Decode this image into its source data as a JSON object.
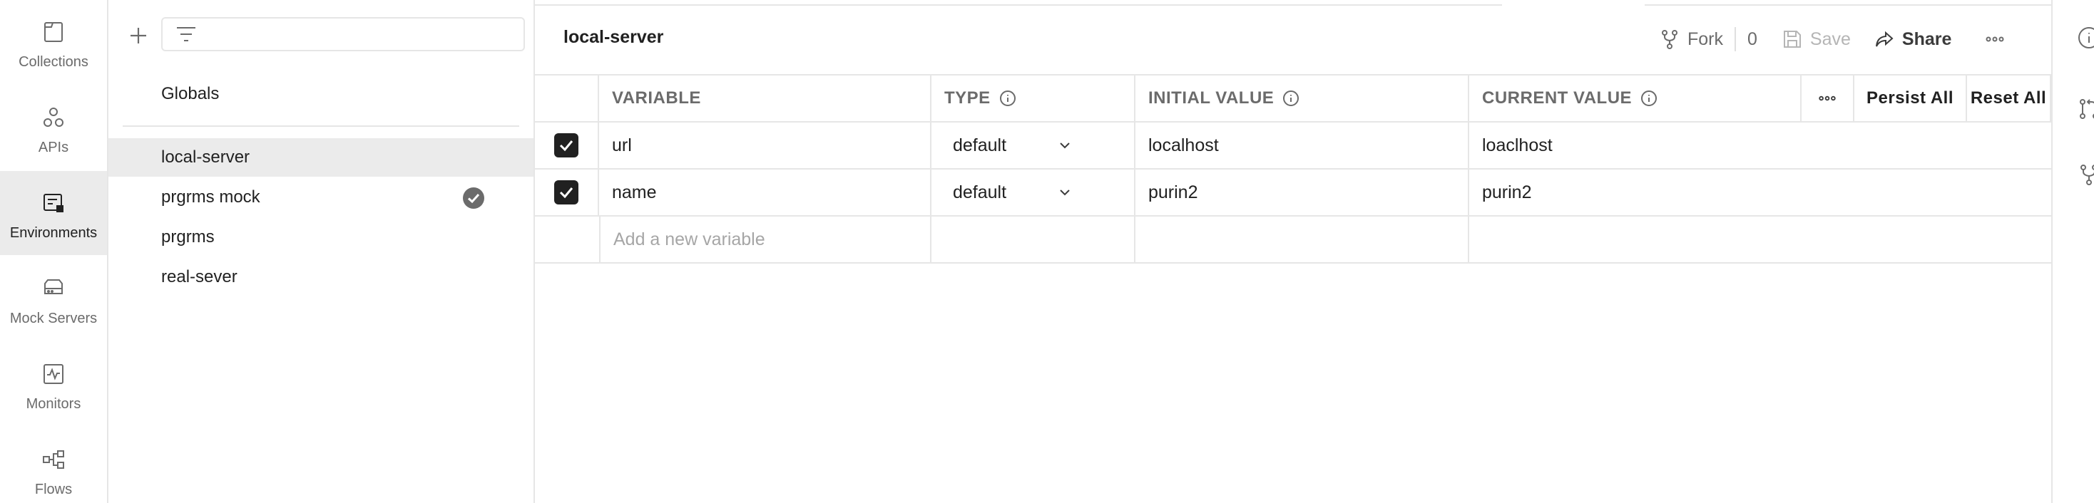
{
  "nav": {
    "items": [
      {
        "label": "Collections",
        "icon": "collections-icon",
        "active": false
      },
      {
        "label": "APIs",
        "icon": "apis-icon",
        "active": false
      },
      {
        "label": "Environments",
        "icon": "environments-icon",
        "active": true
      },
      {
        "label": "Mock Servers",
        "icon": "mock-servers-icon",
        "active": false
      },
      {
        "label": "Monitors",
        "icon": "monitors-icon",
        "active": false
      },
      {
        "label": "Flows",
        "icon": "flows-icon",
        "active": false
      }
    ]
  },
  "sidebar": {
    "filter_placeholder": "",
    "globals_label": "Globals",
    "environments": [
      {
        "name": "local-server",
        "selected": true,
        "active": false
      },
      {
        "name": "prgrms mock",
        "selected": false,
        "active": true
      },
      {
        "name": "prgrms",
        "selected": false,
        "active": false
      },
      {
        "name": "real-sever",
        "selected": false,
        "active": false
      }
    ]
  },
  "main": {
    "title": "local-server",
    "actions": {
      "fork_label": "Fork",
      "fork_count": "0",
      "save_label": "Save",
      "share_label": "Share"
    },
    "table": {
      "headers": {
        "variable": "VARIABLE",
        "type": "TYPE",
        "initial_value": "INITIAL VALUE",
        "current_value": "CURRENT VALUE",
        "persist_all": "Persist All",
        "reset_all": "Reset All"
      },
      "rows": [
        {
          "enabled": true,
          "variable": "url",
          "type": "default",
          "initial_value": "localhost",
          "current_value": "loaclhost"
        },
        {
          "enabled": true,
          "variable": "name",
          "type": "default",
          "initial_value": "purin2",
          "current_value": "purin2"
        }
      ],
      "new_variable_placeholder": "Add a new variable"
    }
  },
  "colors": {
    "active_nav_bg": "#ebebeb",
    "border": "#e6e6e6",
    "checkbox": "#212121",
    "active_check": "#6b6b6b"
  }
}
